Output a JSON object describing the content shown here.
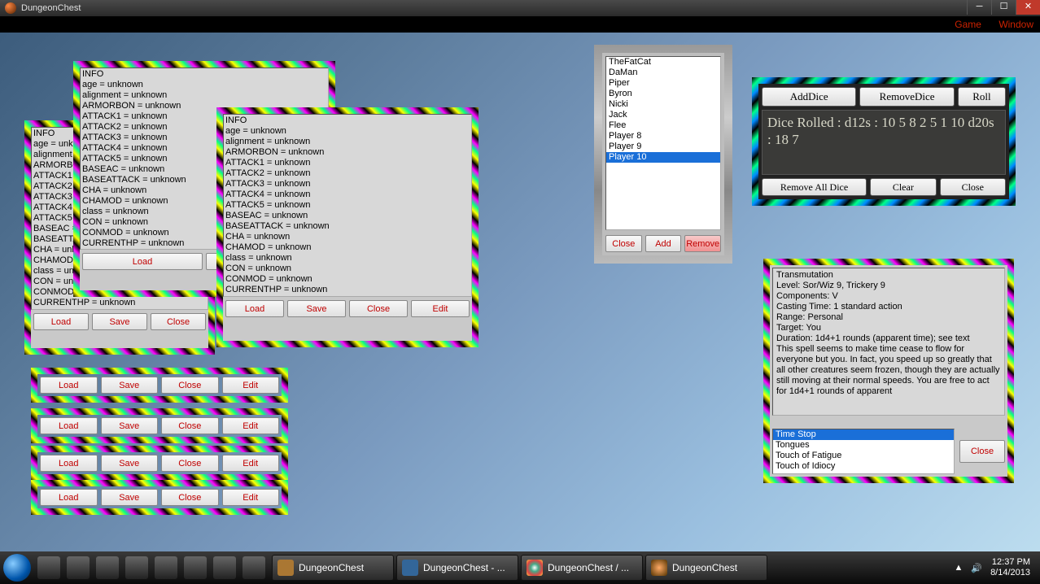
{
  "window": {
    "title": "DungeonChest",
    "menu": {
      "game": "Game",
      "window": "Window"
    }
  },
  "buttons": {
    "load": "Load",
    "save": "Save",
    "close": "Close",
    "edit": "Edit",
    "add": "Add",
    "remove": "Remove"
  },
  "charinfo": "INFO\nage = unknown\nalignment = unknown\nARMORBON = unknown\nATTACK1 = unknown\nATTACK2 = unknown\nATTACK3 = unknown\nATTACK4 = unknown\nATTACK5 = unknown\nBASEAC = unknown\nBASEATTACK = unknown\nCHA = unknown\nCHAMOD = unknown\nclass = unknown\nCON = unknown\nCONMOD = unknown\nCURRENTHP = unknown",
  "players": {
    "items": [
      "TheFatCat",
      "DaMan",
      "Piper",
      "Byron",
      "Nicki",
      "Jack",
      "Flee",
      "Player 8",
      "Player 9",
      "Player 10"
    ],
    "selected": 9
  },
  "dice": {
    "add": "AddDice",
    "remove": "RemoveDice",
    "roll": "Roll",
    "removeall": "Remove All Dice",
    "clear": "Clear",
    "close": "Close",
    "output": "Dice Rolled : d12s : 10 5 8 2 5 1 10 d20s : 18 7"
  },
  "spell": {
    "text": "Transmutation\nLevel: Sor/Wiz 9, Trickery 9\nComponents: V\nCasting Time: 1 standard action\nRange: Personal\nTarget: You\nDuration: 1d4+1 rounds (apparent time); see text\nThis spell seems to make time cease to flow for everyone but you. In fact, you speed up so greatly that all other creatures seem frozen, though they are actually still moving at their normal speeds. You are free to act for 1d4+1 rounds of apparent",
    "list": [
      "Time Stop",
      "Tongues",
      "Touch of Fatigue",
      "Touch of Idiocy"
    ],
    "selected": 0
  },
  "taskbar": {
    "tasks": [
      "DungeonChest",
      "DungeonChest - ...",
      "DungeonChest / ...",
      "DungeonChest"
    ],
    "time": "12:37 PM",
    "date": "8/14/2013"
  }
}
